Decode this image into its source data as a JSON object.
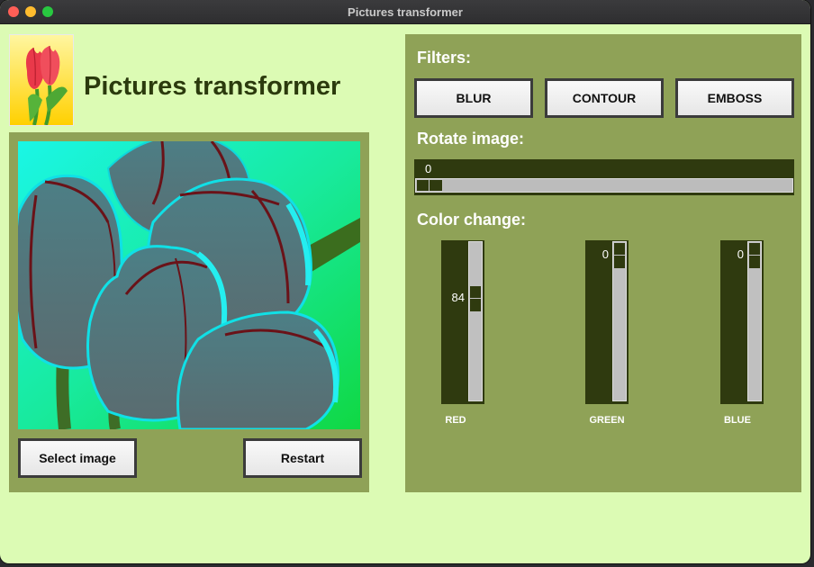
{
  "window": {
    "title": "Pictures transformer"
  },
  "header": {
    "title": "Pictures transformer"
  },
  "left_panel": {
    "select_label": "Select image",
    "restart_label": "Restart"
  },
  "filters": {
    "heading": "Filters:",
    "buttons": [
      "BLUR",
      "CONTOUR",
      "EMBOSS"
    ]
  },
  "rotate": {
    "heading": "Rotate image:",
    "value": "0",
    "fraction": 0
  },
  "color_change": {
    "heading": "Color change:",
    "sliders": [
      {
        "label": "RED",
        "value": "84",
        "fraction": 0.33
      },
      {
        "label": "GREEN",
        "value": "0",
        "fraction": 0
      },
      {
        "label": "BLUE",
        "value": "0",
        "fraction": 0
      }
    ]
  },
  "colors": {
    "background": "#dcfbb4",
    "panel": "#8fa257",
    "slider_dark": "#2f3a0f",
    "title_text": "#2b3a0d"
  },
  "icons": {
    "app_icon": "tulip-icon",
    "preview": "tulip-photo"
  }
}
